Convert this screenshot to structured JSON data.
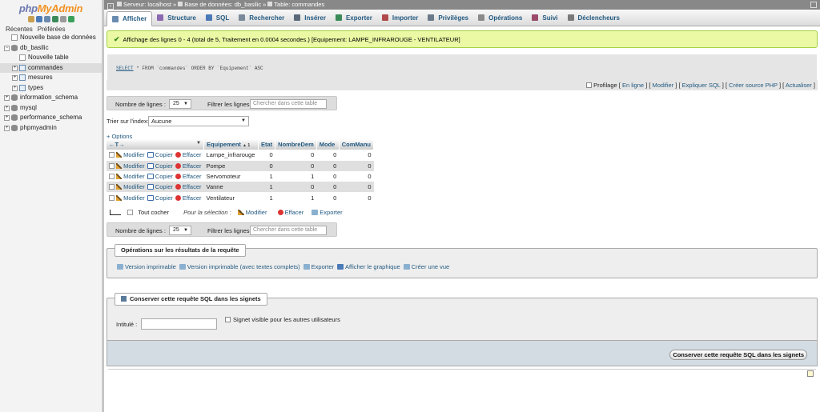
{
  "nav": {
    "logo_php": "php",
    "logo_myadmin": "MyAdmin",
    "tab_recent": "Récentes",
    "tab_favorites": "Préférées",
    "tree": [
      {
        "label": "Nouvelle base de données",
        "level": 0,
        "kind": "new"
      },
      {
        "label": "db_basilic",
        "level": 0,
        "kind": "db",
        "expanded": true
      },
      {
        "label": "Nouvelle table",
        "level": 1,
        "kind": "new"
      },
      {
        "label": "commandes",
        "level": 1,
        "kind": "table",
        "selected": true
      },
      {
        "label": "mesures",
        "level": 1,
        "kind": "table"
      },
      {
        "label": "types",
        "level": 1,
        "kind": "table"
      },
      {
        "label": "information_schema",
        "level": 0,
        "kind": "db"
      },
      {
        "label": "mysql",
        "level": 0,
        "kind": "db"
      },
      {
        "label": "performance_schema",
        "level": 0,
        "kind": "db"
      },
      {
        "label": "phpmyadmin",
        "level": 0,
        "kind": "db"
      }
    ]
  },
  "breadcrumb": {
    "server": "Serveur: localhost",
    "database": "Base de données: db_basilic",
    "table": "Table: commandes",
    "separator": "»"
  },
  "tabs": [
    {
      "label": "Afficher",
      "active": true,
      "color": "#6a8bb0"
    },
    {
      "label": "Structure",
      "color": "#8a6ab0"
    },
    {
      "label": "SQL",
      "color": "#4a7ab8"
    },
    {
      "label": "Rechercher",
      "color": "#7a8a9a"
    },
    {
      "label": "Insérer",
      "color": "#5a6a7a"
    },
    {
      "label": "Exporter",
      "color": "#3a8a5a"
    },
    {
      "label": "Importer",
      "color": "#b04a4a"
    },
    {
      "label": "Privilèges",
      "color": "#6a7a8a"
    },
    {
      "label": "Opérations",
      "color": "#8a8a8a"
    },
    {
      "label": "Suivi",
      "color": "#9a4a6a"
    },
    {
      "label": "Déclencheurs",
      "color": "#7a7a7a"
    }
  ],
  "message": "Affichage des lignes 0 - 4 (total de 5, Traitement en 0.0004 secondes.) [Equipement: LAMPE_INFRAROUGE - VENTILATEUR]",
  "sql": {
    "select": "SELECT",
    "rest": " * FROM `commandes` ORDER BY `Equipement` ASC"
  },
  "profiling": {
    "label": "Profilage",
    "links": [
      "En ligne",
      "Modifier",
      "Expliquer SQL",
      "Créer source PHP",
      "Actualiser"
    ]
  },
  "pager": {
    "rows_label": "Nombre de lignes :",
    "rows_value": "25",
    "filter_label": "Filtrer les lignes:",
    "filter_placeholder": "Chercher dans cette table"
  },
  "sort": {
    "label": "Trier sur l'index:",
    "value": "Aucune"
  },
  "options_label": "+ Options",
  "table": {
    "columns": [
      "Equipement",
      "Etat",
      "NombreDem",
      "Mode",
      "ComManu"
    ],
    "sort_arrows": "▲ 1",
    "nav_arrows": "←T→",
    "action_edit": "Modifier",
    "action_copy": "Copier",
    "action_delete": "Effacer",
    "rows": [
      [
        "Lampe_infrarouge",
        "0",
        "0",
        "0",
        "0"
      ],
      [
        "Pompe",
        "0",
        "0",
        "0",
        "0"
      ],
      [
        "Servomoteur",
        "1",
        "1",
        "0",
        "0"
      ],
      [
        "Vanne",
        "1",
        "0",
        "0",
        "0"
      ],
      [
        "Ventilateur",
        "1",
        "1",
        "0",
        "0"
      ]
    ]
  },
  "bulk": {
    "check_all": "Tout cocher",
    "with_selected": "Pour la sélection :",
    "edit": "Modifier",
    "delete": "Effacer",
    "export": "Exporter"
  },
  "query_ops": {
    "title": "Opérations sur les résultats de la requête",
    "items": [
      "Version imprimable",
      "Version imprimable (avec textes complets)",
      "Exporter",
      "Afficher le graphique",
      "Créer une vue"
    ]
  },
  "bookmark": {
    "title": "Conserver cette requête SQL dans les signets",
    "label": "Intitulé :",
    "shared_label": "Signet visible pour les autres utilisateurs",
    "button": "Conserver cette requête SQL dans les signets"
  }
}
